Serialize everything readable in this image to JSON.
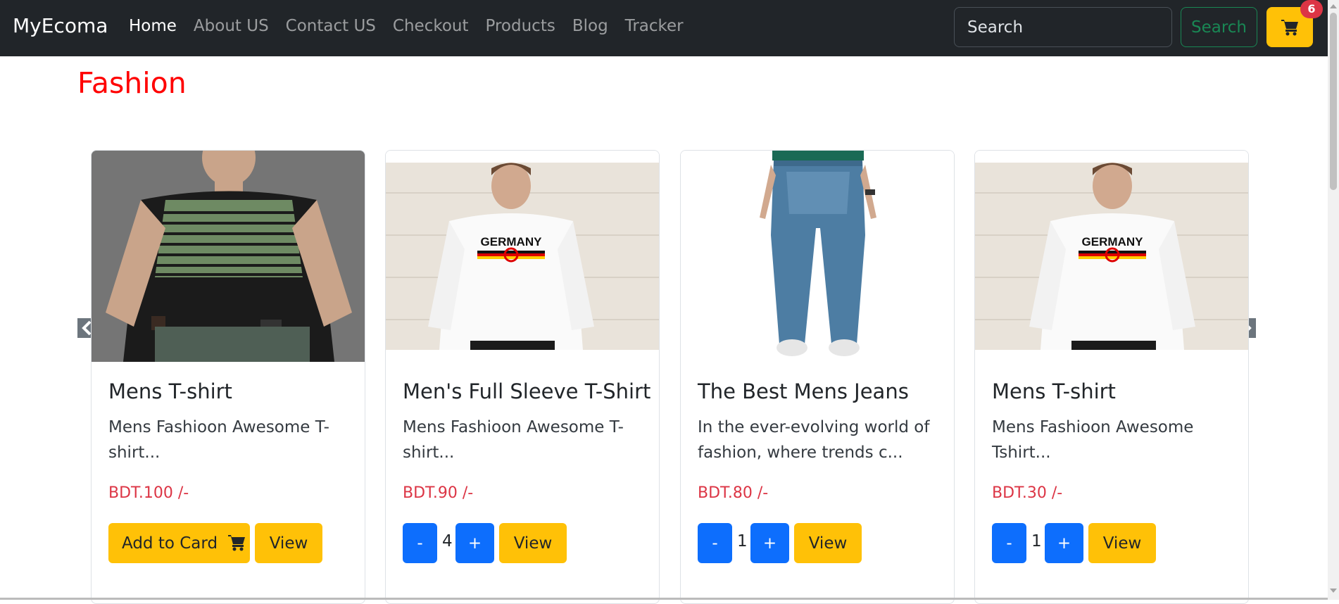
{
  "navbar": {
    "brand": "MyEcoma",
    "links": [
      "Home",
      "About US",
      "Contact US",
      "Checkout",
      "Products",
      "Blog",
      "Tracker"
    ],
    "search_placeholder": "Search",
    "search_button": "Search",
    "cart_count": "6"
  },
  "section": {
    "title": "Fashion"
  },
  "products": [
    {
      "title": "Mens T-shirt",
      "text": "Mens Fashioon Awesome T-shirt...",
      "price": "BDT.100 /-",
      "action": "Add to Card",
      "view": "View"
    },
    {
      "title": "Men's Full Sleeve T-Shirt",
      "text": "Mens Fashioon Awesome T-shirt...",
      "price": "BDT.90 /-",
      "minus": "-",
      "qty": "4",
      "plus": "+",
      "view": "View"
    },
    {
      "title": "The Best Mens Jeans",
      "text": "In the ever-evolving world of fashion, where trends c...",
      "price": "BDT.80 /-",
      "minus": "-",
      "qty": "1",
      "plus": "+",
      "view": "View"
    },
    {
      "title": "Mens T-shirt",
      "text": "Mens Fashioon Awesome Tshirt...",
      "price": "BDT.30 /-",
      "minus": "-",
      "qty": "1",
      "plus": "+",
      "view": "View"
    }
  ],
  "colors": {
    "navbar_bg": "#212529",
    "accent": "#ffc107",
    "primary": "#0d6efd",
    "price": "#dc3545",
    "title": "#ff0000"
  }
}
